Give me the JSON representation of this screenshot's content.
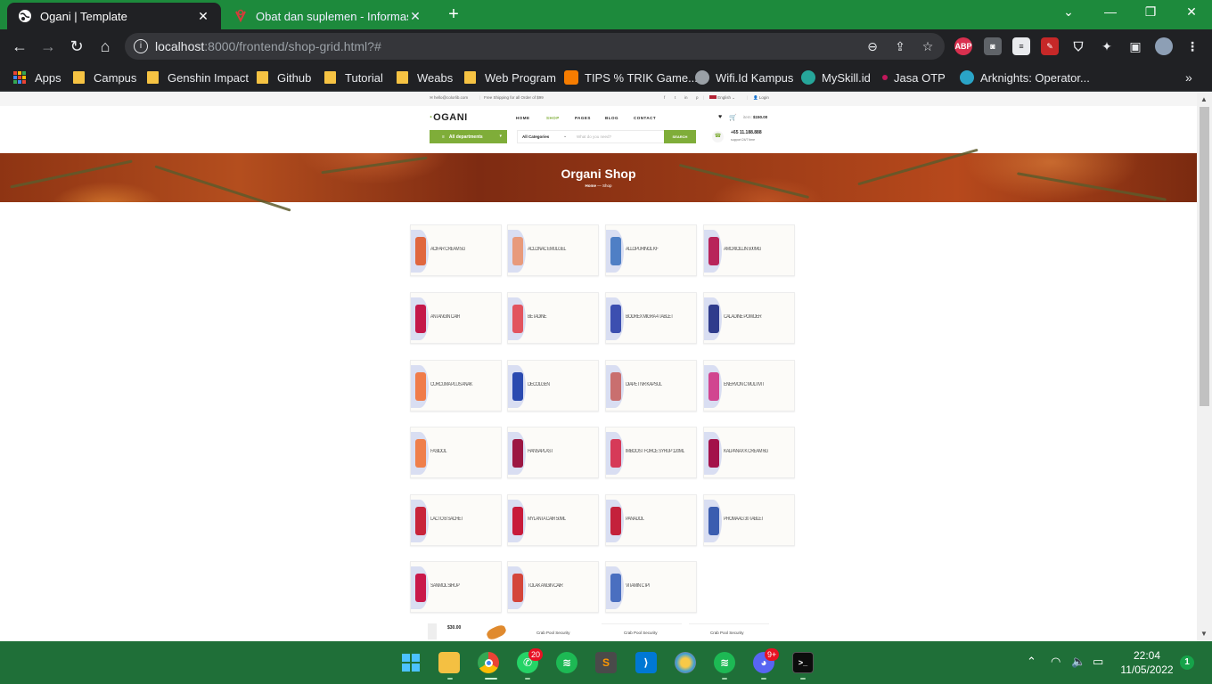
{
  "browser": {
    "tabs": [
      {
        "title": "Ogani | Template",
        "active": true
      },
      {
        "title": "Obat dan suplemen - Informasi k",
        "active": false
      }
    ],
    "url_host": "localhost",
    "url_rest": ":8000/frontend/shop-grid.html?#",
    "extensions": [
      "ABP"
    ]
  },
  "bookmarks": {
    "items": [
      {
        "label": "Apps",
        "type": "apps"
      },
      {
        "label": "Campus",
        "type": "folder"
      },
      {
        "label": "Genshin Impact",
        "type": "folder"
      },
      {
        "label": "Github",
        "type": "folder"
      },
      {
        "label": "Tutorial",
        "type": "folder"
      },
      {
        "label": "Weabs",
        "type": "folder"
      },
      {
        "label": "Web Program",
        "type": "folder"
      },
      {
        "label": "TIPS % TRIK Game...",
        "type": "blogger"
      },
      {
        "label": "Wifi.Id Kampus",
        "type": "globe"
      },
      {
        "label": "MySkill.id",
        "type": "myskill"
      },
      {
        "label": "Jasa OTP",
        "type": "otp"
      },
      {
        "label": "Arknights: Operator...",
        "type": "arknights"
      }
    ]
  },
  "site": {
    "topbar": {
      "email": "hello@colorlib.com",
      "shipping": "Free Shipping for all Order of $99",
      "language": "English",
      "login": "Login"
    },
    "logo": "OGANI",
    "menu": [
      "HOME",
      "SHOP",
      "PAGES",
      "BLOG",
      "CONTACT"
    ],
    "active_menu": "SHOP",
    "cart": {
      "label": "item:",
      "total": "$150.00"
    },
    "departments_label": "All departments",
    "search": {
      "category": "All Categories",
      "placeholder": "What do you need?",
      "button": "SEARCH"
    },
    "phone": {
      "number": "+65 11.188.888",
      "sub": "support 24/7 time"
    },
    "hero": {
      "title": "Organi Shop",
      "breadcrumb_home": "Home",
      "breadcrumb_current": "Shop"
    },
    "products": [
      {
        "title": "ACIFAR CREAM 5G",
        "color": "#e0673f"
      },
      {
        "title": "ACLONAC EMULGEL",
        "color": "#e89a7b"
      },
      {
        "title": "ALLOPURINOL KF",
        "color": "#4f7fc5"
      },
      {
        "title": "AMOXICILLIN 500MG",
        "color": "#b8245a"
      },
      {
        "title": "ANTANGIN CAIR",
        "color": "#c4184a"
      },
      {
        "title": "BETADINE",
        "color": "#e2545f"
      },
      {
        "title": "BODREX MIGRA 4 TABLET",
        "color": "#3c4fb0"
      },
      {
        "title": "CALADINE POWDER",
        "color": "#2f3c8c"
      },
      {
        "title": "CURCUMA PLUS ANAK",
        "color": "#f07c4a"
      },
      {
        "title": "DECOLGEN",
        "color": "#2a4ab0"
      },
      {
        "title": "DIAPET NR KAPSUL",
        "color": "#c96f6f"
      },
      {
        "title": "ENERVON C MULTIVIT",
        "color": "#d14590"
      },
      {
        "title": "FASIDOL",
        "color": "#ef7f4b"
      },
      {
        "title": "HANSAPLAST",
        "color": "#9c1742"
      },
      {
        "title": "IMBOOST FORCE SYRUP 120ML",
        "color": "#d63a58"
      },
      {
        "title": "KALPANAX K CREAM 6G",
        "color": "#a3124a"
      },
      {
        "title": "LACTO B SACHET",
        "color": "#c8243b"
      },
      {
        "title": "MYLANTA CAIR 50ML",
        "color": "#c81a3a"
      },
      {
        "title": "PANADOL",
        "color": "#c4213b"
      },
      {
        "title": "PROMAAG 30 TABLET",
        "color": "#3b5db0"
      },
      {
        "title": "SANMOL SIRUP",
        "color": "#c9184a"
      },
      {
        "title": "TOLAK ANGIN CAIR",
        "color": "#d4453a"
      },
      {
        "title": "VITAMIN C IPI",
        "color": "#4a6fc0"
      }
    ],
    "bottom_strip": {
      "price": "$30.00",
      "items": [
        "Crab Pool Security",
        "Crab Pool Security",
        "Crab Pool Security"
      ]
    }
  },
  "taskbar": {
    "apps": [
      "windows-start",
      "file-explorer",
      "chrome",
      "whatsapp",
      "spotify",
      "sublime-text",
      "vscode",
      "davinci",
      "spotify",
      "discord",
      "terminal"
    ],
    "whatsapp_badge": "20",
    "discord_badge": "9+",
    "time": "22:04",
    "date": "11/05/2022",
    "notifications": "1"
  },
  "colors": {
    "accent": "#7fad39",
    "chrome_green": "#1d8a3c",
    "taskbar": "#1f6f38"
  }
}
